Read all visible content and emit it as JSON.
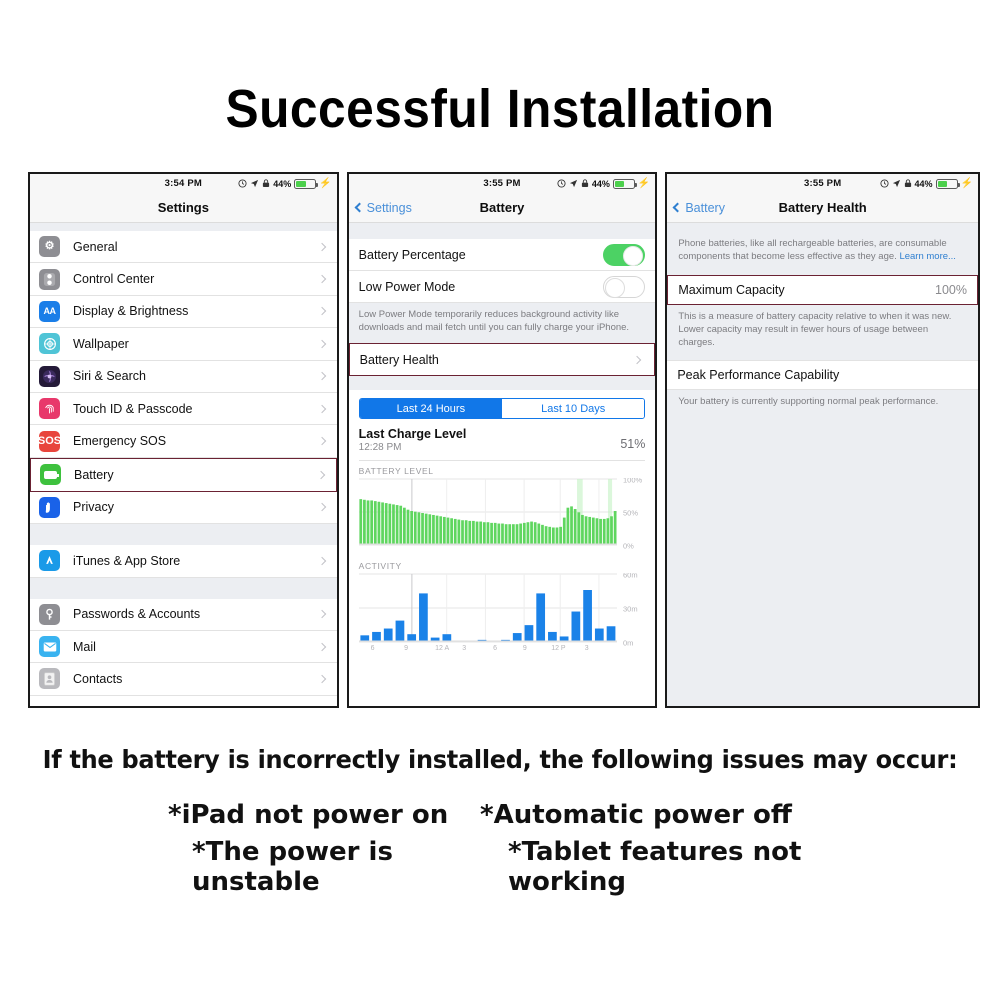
{
  "title": "Successful Installation",
  "settings_panel": {
    "status_bar": {
      "time": "3:54 PM",
      "battery_percent": "44%",
      "icons": [
        "alarm-icon",
        "location-arrow-icon",
        "orientation-lock-icon",
        "battery-icon",
        "charging-bolt-icon"
      ]
    },
    "nav_title": "Settings",
    "groups": [
      {
        "items": [
          {
            "label": "General",
            "icon": "gear-icon",
            "icon_color": "#8e8e93"
          },
          {
            "label": "Control Center",
            "icon": "control-center-icon",
            "icon_color": "#8e8e93"
          },
          {
            "label": "Display & Brightness",
            "icon": "display-brightness-icon",
            "icon_color": "#1a7ee8"
          },
          {
            "label": "Wallpaper",
            "icon": "wallpaper-icon",
            "icon_color": "#4fc4d6"
          },
          {
            "label": "Siri & Search",
            "icon": "siri-icon",
            "icon_color": "#241a38"
          },
          {
            "label": "Touch ID & Passcode",
            "icon": "touch-id-icon",
            "icon_color": "#e8386b"
          },
          {
            "label": "Emergency SOS",
            "icon": "sos-icon",
            "icon_color": "#e8453c"
          },
          {
            "label": "Battery",
            "icon": "battery-icon",
            "icon_color": "#3ec13e",
            "highlighted": true
          },
          {
            "label": "Privacy",
            "icon": "privacy-hand-icon",
            "icon_color": "#1a62e8"
          }
        ]
      },
      {
        "items": [
          {
            "label": "iTunes & App Store",
            "icon": "app-store-icon",
            "icon_color": "#1a9ae8"
          }
        ]
      },
      {
        "items": [
          {
            "label": "Passwords & Accounts",
            "icon": "key-icon",
            "icon_color": "#8e8e93"
          },
          {
            "label": "Mail",
            "icon": "mail-icon",
            "icon_color": "#39b3f0"
          },
          {
            "label": "Contacts",
            "icon": "contacts-icon",
            "icon_color": "#b9b9bd"
          }
        ]
      }
    ],
    "highlight_color": "#6b2233"
  },
  "battery_panel": {
    "status_bar": {
      "time": "3:55 PM",
      "battery_percent": "44%"
    },
    "back_label": "Settings",
    "nav_title": "Battery",
    "battery_percentage_label": "Battery Percentage",
    "battery_percentage_on": true,
    "low_power_label": "Low Power Mode",
    "low_power_on": false,
    "low_power_note": "Low Power Mode temporarily reduces background activity like downloads and mail fetch until you can fully charge your iPhone.",
    "battery_health_label": "Battery Health",
    "segments": [
      {
        "label": "Last 24 Hours",
        "active": true
      },
      {
        "label": "Last 10 Days",
        "active": false
      }
    ],
    "last_charge_title": "Last Charge Level",
    "last_charge_time": "12:28 PM",
    "last_charge_percent": "51%",
    "battery_level_header": "BATTERY LEVEL",
    "activity_header": "ACTIVITY"
  },
  "battery_health_panel": {
    "status_bar": {
      "time": "3:55 PM",
      "battery_percent": "44%"
    },
    "back_label": "Battery",
    "nav_title": "Battery Health",
    "intro_text": "Phone batteries, like all rechargeable batteries, are consumable components that become less effective as they age. ",
    "intro_link": "Learn more...",
    "max_capacity_label": "Maximum Capacity",
    "max_capacity_value": "100%",
    "max_capacity_note": "This is a measure of battery capacity relative to when it was new. Lower capacity may result in fewer hours of usage between charges.",
    "peak_label": "Peak Performance Capability",
    "peak_note": "Your battery is currently supporting normal peak performance."
  },
  "warning": {
    "headline": "If the battery is incorrectly installed, the following issues may occur:",
    "issues": [
      [
        "*iPad not power on",
        "*Automatic power off"
      ],
      [
        "*The power is unstable",
        "*Tablet features not working"
      ]
    ]
  },
  "chart_data": [
    {
      "type": "area",
      "title": "BATTERY LEVEL",
      "ylabel": "",
      "ylim": [
        0,
        100
      ],
      "ytick_labels": [
        "100%",
        "50%",
        "0%"
      ],
      "yticks": [
        100,
        50,
        0
      ],
      "color": "#5fd65f",
      "x": [
        "6",
        "9",
        "12 A",
        "3",
        "6",
        "9",
        "12 P",
        "3"
      ],
      "values": [
        68,
        67,
        66,
        66,
        65,
        64,
        63,
        62,
        61,
        60,
        59,
        58,
        55,
        52,
        50,
        49,
        48,
        47,
        46,
        45,
        44,
        43,
        42,
        41,
        40,
        39,
        38,
        37,
        36,
        36,
        35,
        35,
        34,
        34,
        33,
        33,
        32,
        32,
        31,
        31,
        30,
        30,
        30,
        30,
        31,
        32,
        33,
        34,
        33,
        31,
        29,
        27,
        26,
        25,
        25,
        26,
        40,
        55,
        57,
        53,
        48,
        44,
        42,
        41,
        40,
        39,
        38,
        38,
        39,
        42,
        50
      ]
    },
    {
      "type": "bar",
      "title": "ACTIVITY",
      "ylabel": "",
      "ylim": [
        0,
        60
      ],
      "ytick_labels": [
        "60m",
        "30m",
        "0m"
      ],
      "yticks": [
        60,
        30,
        0
      ],
      "color": "#1a82e8",
      "x": [
        "6",
        "9",
        "12 A",
        "3",
        "6",
        "9",
        "12 P",
        "3"
      ],
      "values": [
        5,
        8,
        11,
        18,
        6,
        42,
        3,
        6,
        0,
        0,
        1,
        0,
        1,
        7,
        14,
        42,
        8,
        4,
        26,
        45,
        11,
        13
      ]
    }
  ]
}
